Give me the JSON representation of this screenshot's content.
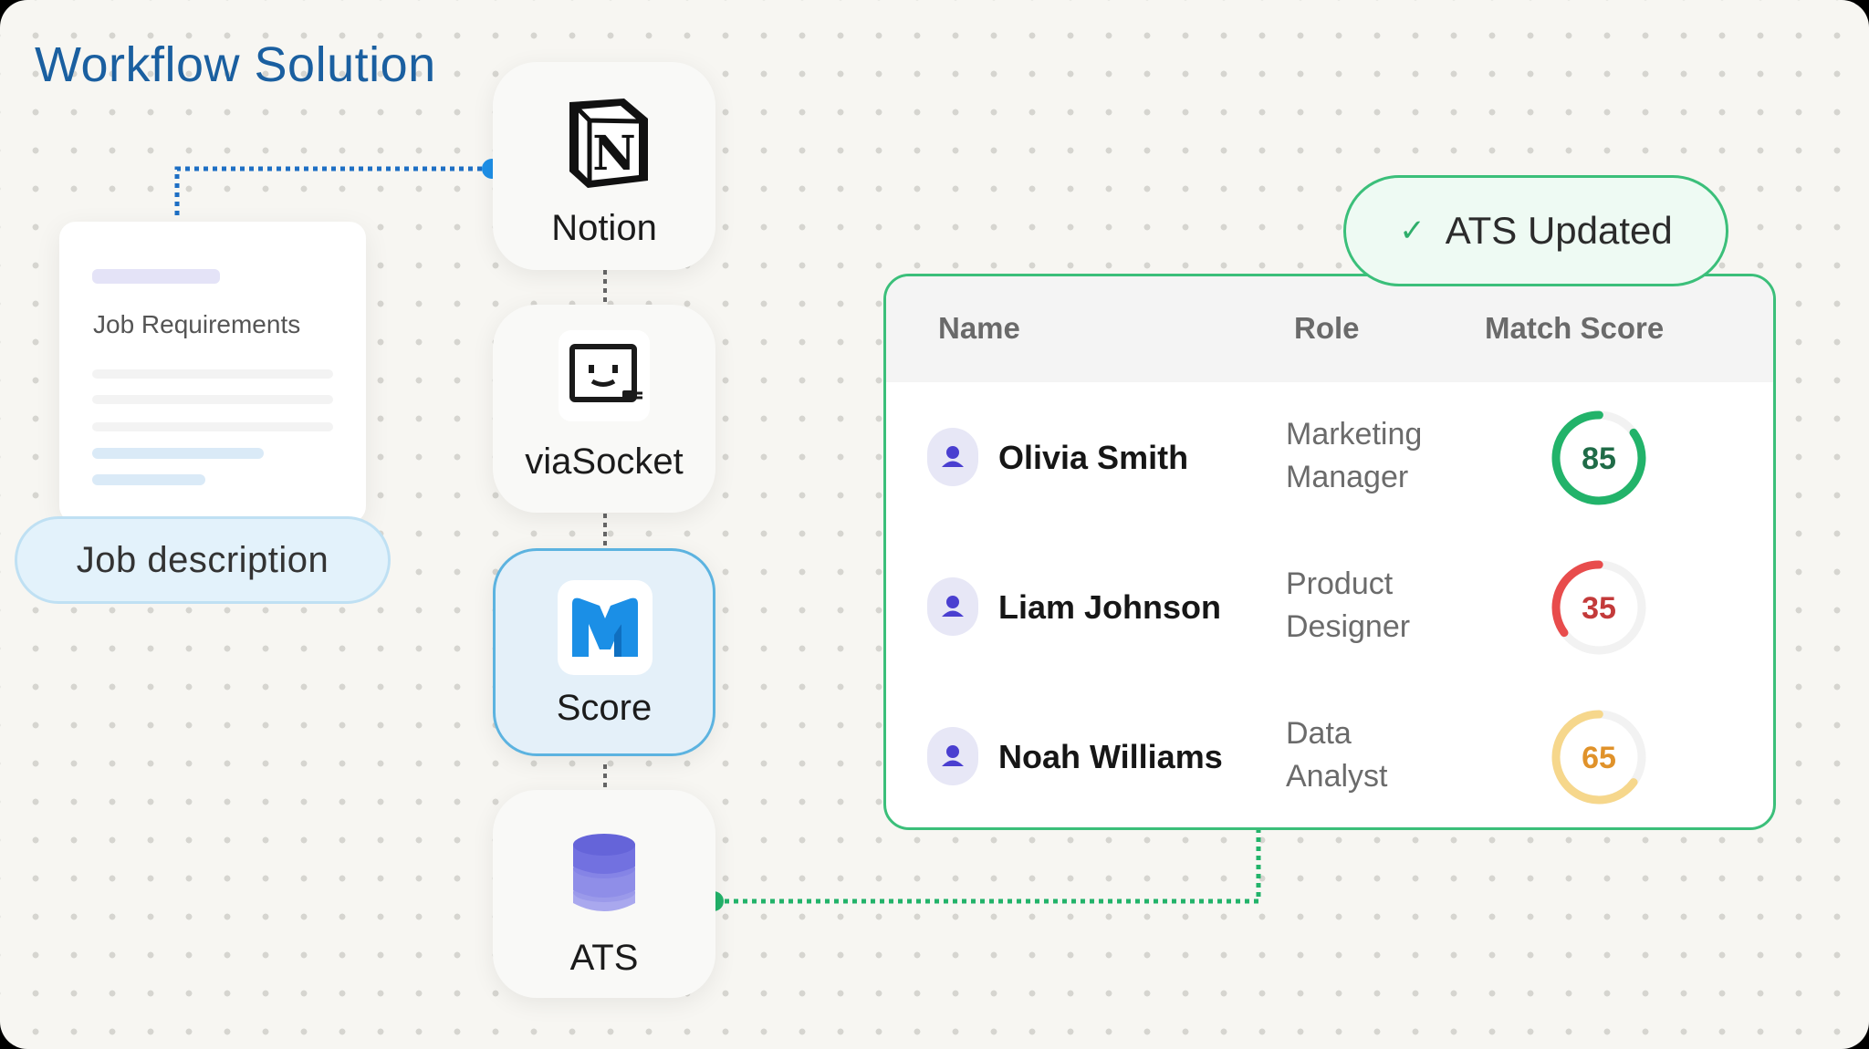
{
  "title": "Workflow Solution",
  "job_doc": {
    "label": "Job Requirements"
  },
  "job_pill": "Job description",
  "steps": [
    {
      "label": "Notion",
      "icon": "notion-logo-icon"
    },
    {
      "label": "viaSocket",
      "icon": "viasocket-bot-icon"
    },
    {
      "label": "Score",
      "icon": "score-logo-icon"
    },
    {
      "label": "ATS",
      "icon": "database-icon"
    }
  ],
  "badge": "ATS Updated",
  "table": {
    "headers": {
      "name": "Name",
      "role": "Role",
      "score": "Match Score"
    },
    "rows": [
      {
        "name": "Olivia Smith",
        "role_1": "Marketing",
        "role_2": "Manager",
        "score": "85",
        "score_value": 85,
        "color": "#22b36a",
        "text_color": "#1f6b47"
      },
      {
        "name": "Liam Johnson",
        "role_1": "Product",
        "role_2": "Designer",
        "score": "35",
        "score_value": 35,
        "color": "#e84c4c",
        "text_color": "#c33a3a"
      },
      {
        "name": "Noah Williams",
        "role_1": "Data",
        "role_2": "Analyst",
        "score": "65",
        "score_value": 65,
        "color": "#f6d78c",
        "text_color": "#e0922a"
      }
    ]
  },
  "colors": {
    "blue_connector": "#1e90e8",
    "green_connector": "#22b36a",
    "accent": "#3bbf7a"
  }
}
